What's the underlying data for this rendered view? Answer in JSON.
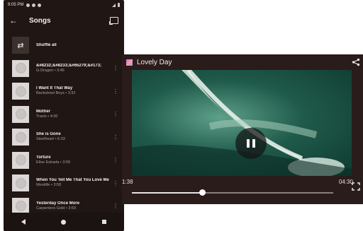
{
  "status_bar": {
    "time": "9:05 PM"
  },
  "toolbar": {
    "title": "Songs",
    "back_icon": "arrow-back-icon",
    "cast_icon": "cast-icon"
  },
  "shuffle": {
    "label": "Shuffle all",
    "icon": "shuffle-icon"
  },
  "songs": [
    {
      "title": "&#8232;&#8233;&#65279;&#173;",
      "subtitle": "G-Dragon • 3:46"
    },
    {
      "title": "I Want It That Way",
      "subtitle": "Backstreet Boys • 3:32"
    },
    {
      "title": "Mother",
      "subtitle": "Travis • 4:00"
    },
    {
      "title": "She is Gone",
      "subtitle": "Steelheart • 6:33"
    },
    {
      "title": "Torture",
      "subtitle": "Elise Estrada • 3:59"
    },
    {
      "title": "When You Tell Me That You Love Me",
      "subtitle": "Westlife • 3:58"
    },
    {
      "title": "Yesterday Once More",
      "subtitle": "Carpenters Gold • 3:59"
    }
  ],
  "player": {
    "title": "Lovely Day",
    "current_time": "1:38",
    "duration": "04:30",
    "progress": 0.35,
    "state": "playing"
  },
  "colors": {
    "phone_bg": "#201614",
    "player_bg": "#2a1c1a"
  }
}
